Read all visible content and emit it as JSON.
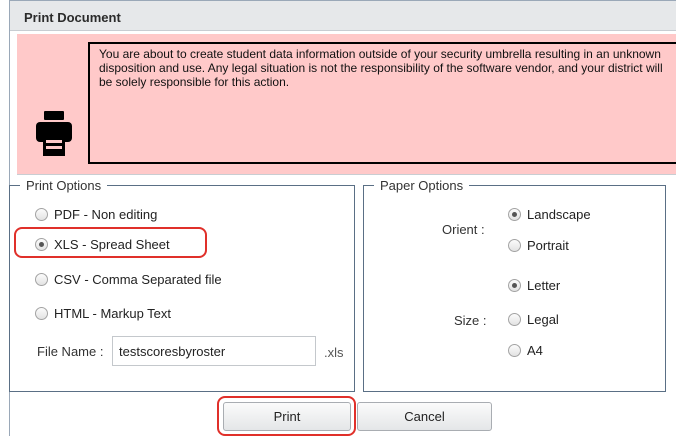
{
  "dialog": {
    "title": "Print Document"
  },
  "warning": {
    "icon": "printer-icon",
    "text": "You are about to create student data information outside of your security umbrella resulting in an unknown disposition and use. Any legal situation is not the responsibility of the software vendor, and your district will be solely responsible for this action.",
    "background": "#ffc9c9"
  },
  "print_options": {
    "legend": "Print Options",
    "options": [
      {
        "label": "PDF - Non editing",
        "checked": false
      },
      {
        "label": "XLS - Spread Sheet",
        "checked": true
      },
      {
        "label": "CSV - Comma Separated file",
        "checked": false
      },
      {
        "label": "HTML - Markup Text",
        "checked": false
      }
    ],
    "file_name_label": "File Name :",
    "file_name_value": "testscoresbyroster",
    "extension": ".xls"
  },
  "paper_options": {
    "legend": "Paper Options",
    "orient_label": "Orient :",
    "orient_options": [
      {
        "label": "Landscape",
        "checked": true
      },
      {
        "label": "Portrait",
        "checked": false
      }
    ],
    "size_label": "Size :",
    "size_options": [
      {
        "label": "Letter",
        "checked": true
      },
      {
        "label": "Legal",
        "checked": false
      },
      {
        "label": "A4",
        "checked": false
      }
    ]
  },
  "buttons": {
    "print": "Print",
    "cancel": "Cancel"
  },
  "colors": {
    "annotation_highlight": "#e0302a"
  }
}
